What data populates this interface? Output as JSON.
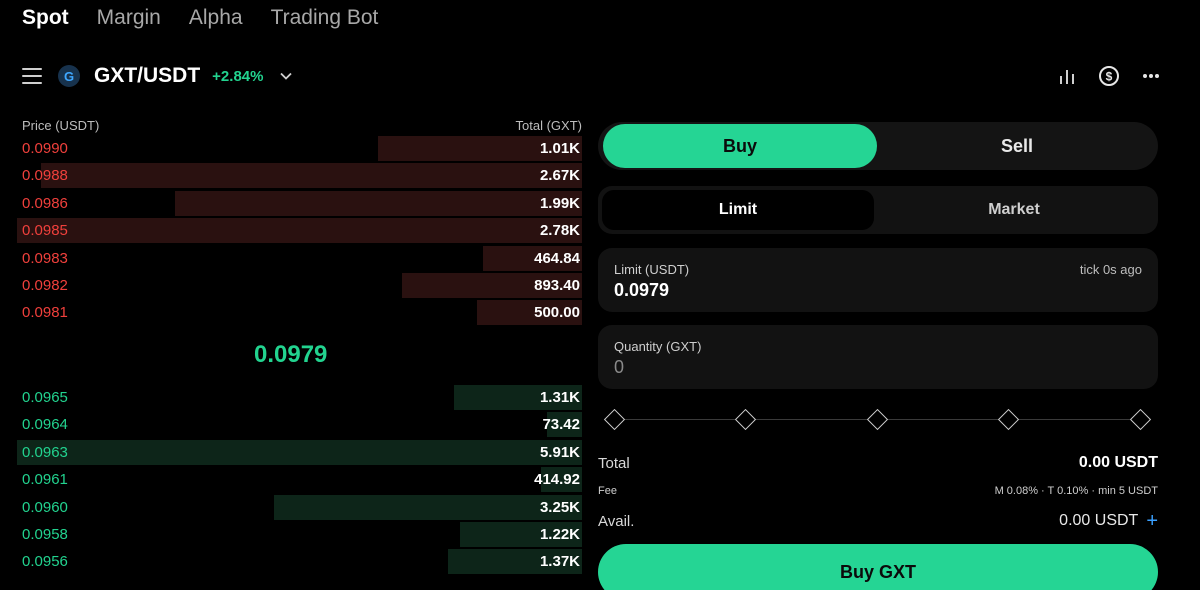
{
  "top_tabs": [
    {
      "label": "Spot"
    },
    {
      "label": "Margin"
    },
    {
      "label": "Alpha"
    },
    {
      "label": "Trading Bot"
    }
  ],
  "pair": {
    "logo_letter": "G",
    "name": "GXT/USDT",
    "change": "+2.84%"
  },
  "icons": {
    "menu": "menu-icon",
    "chart": "bar-chart-icon",
    "currency": "dollar-circle-icon",
    "more": "more-dots-icon"
  },
  "orderbook": {
    "price_header": "Price (USDT)",
    "total_header": "Total (GXT)",
    "mid_price": "0.0979",
    "asks": [
      {
        "price": "0.0990",
        "total": "1.01K",
        "depth": 0.35
      },
      {
        "price": "0.0988",
        "total": "2.67K",
        "depth": 0.93
      },
      {
        "price": "0.0986",
        "total": "1.99K",
        "depth": 0.7
      },
      {
        "price": "0.0985",
        "total": "2.78K",
        "depth": 0.97
      },
      {
        "price": "0.0983",
        "total": "464.84",
        "depth": 0.17
      },
      {
        "price": "0.0982",
        "total": "893.40",
        "depth": 0.31
      },
      {
        "price": "0.0981",
        "total": "500.00",
        "depth": 0.18
      }
    ],
    "bids": [
      {
        "price": "0.0965",
        "total": "1.31K",
        "depth": 0.22
      },
      {
        "price": "0.0964",
        "total": "73.42",
        "depth": 0.06
      },
      {
        "price": "0.0963",
        "total": "5.91K",
        "depth": 0.97
      },
      {
        "price": "0.0961",
        "total": "414.92",
        "depth": 0.07
      },
      {
        "price": "0.0960",
        "total": "3.25K",
        "depth": 0.53
      },
      {
        "price": "0.0958",
        "total": "1.22K",
        "depth": 0.21
      },
      {
        "price": "0.0956",
        "total": "1.37K",
        "depth": 0.23
      }
    ]
  },
  "trade": {
    "buy_label": "Buy",
    "sell_label": "Sell",
    "limit_tab": "Limit",
    "market_tab": "Market",
    "limit_field_label": "Limit (USDT)",
    "limit_value": "0.0979",
    "tick_hint": "tick 0s ago",
    "quantity_label": "Quantity (GXT)",
    "quantity_placeholder": "0",
    "slider_steps": [
      0,
      25,
      50,
      75,
      100
    ],
    "total_label": "Total",
    "total_value": "0.00 USDT",
    "fee_label": "Fee",
    "fee_value": "M 0.08% · T 0.10% · min 5 USDT",
    "avail_label": "Avail.",
    "avail_value": "0.00 USDT",
    "avail_add": "+",
    "submit_label": "Buy GXT"
  },
  "colors": {
    "accent_green": "#25d594",
    "ask_red": "#f0403c",
    "bid_green": "#22d38f"
  }
}
